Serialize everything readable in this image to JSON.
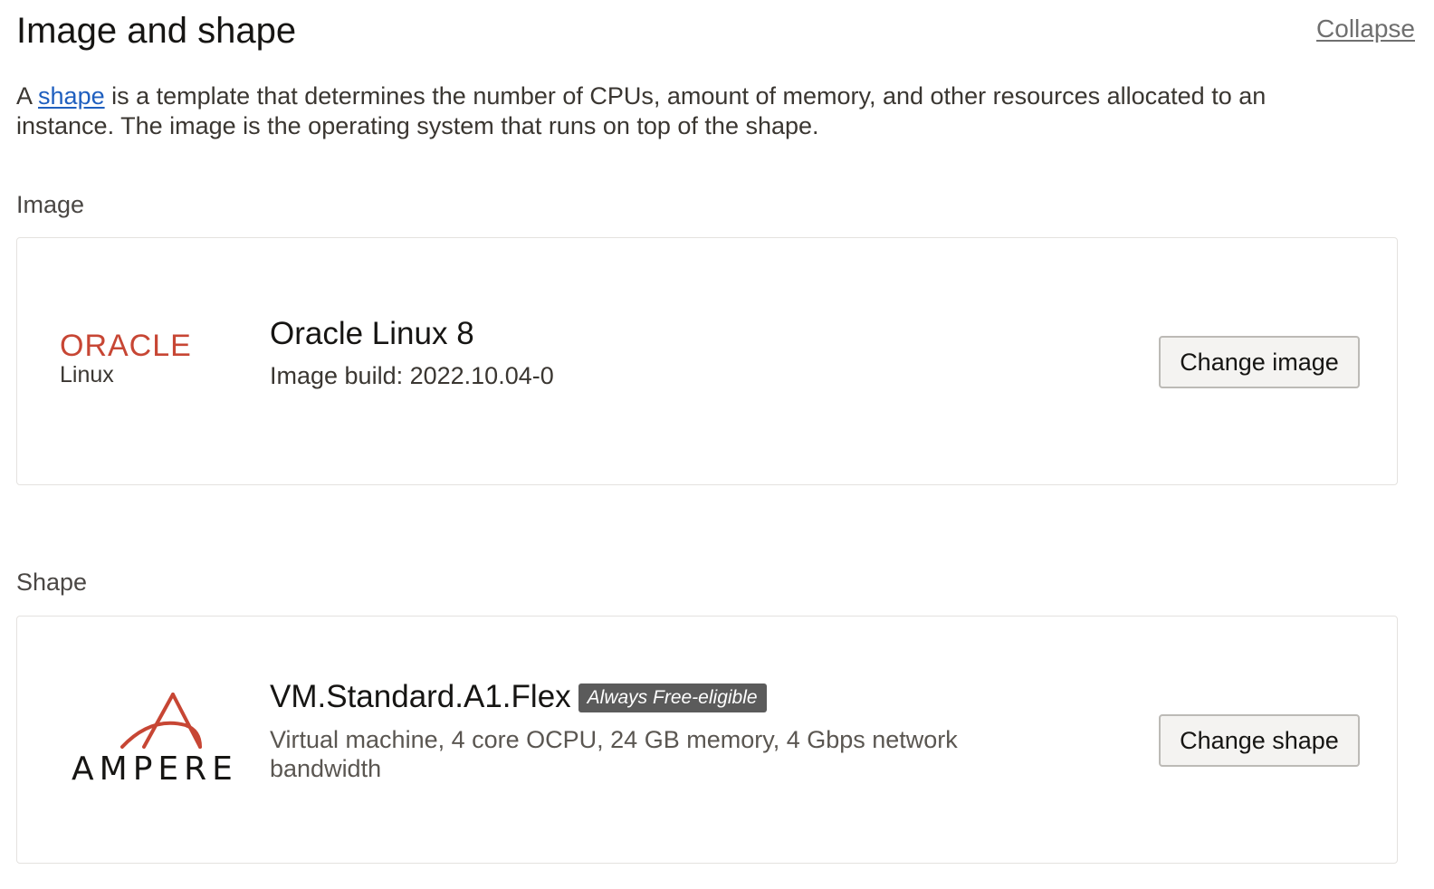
{
  "header": {
    "title": "Image and shape",
    "collapse_label": "Collapse"
  },
  "description": {
    "prefix": "A ",
    "link_text": "shape",
    "suffix": " is a template that determines the number of CPUs, amount of memory, and other resources allocated to an instance. The image is the operating system that runs on top of the shape."
  },
  "image_section": {
    "label": "Image",
    "logo_word": "ORACLE",
    "logo_sub": "Linux",
    "name": "Oracle Linux 8",
    "build": "Image build: 2022.10.04-0",
    "button_label": "Change image"
  },
  "shape_section": {
    "label": "Shape",
    "logo_word": "AMPERE",
    "name": "VM.Standard.A1.Flex",
    "badge": "Always Free-eligible",
    "details": "Virtual machine, 4 core OCPU, 24 GB memory, 4 Gbps network bandwidth",
    "button_label": "Change shape"
  },
  "colors": {
    "oracle_red": "#c74634",
    "link_blue": "#1f5fbf",
    "badge_bg": "#5b5b5b"
  }
}
